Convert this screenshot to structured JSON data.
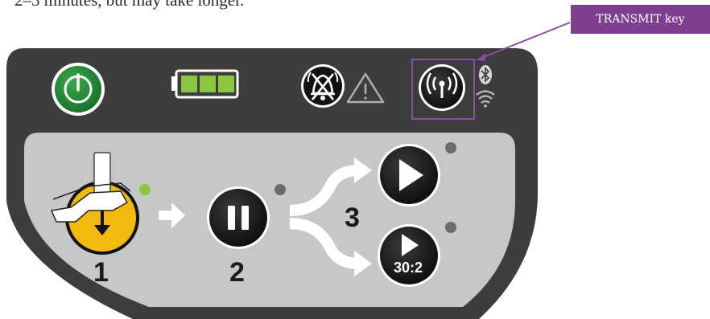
{
  "intro_text": "2–3 minutes, but may take longer.",
  "callout": {
    "label": "TRANSMIT key"
  },
  "status_bar": {
    "power_icon": "power-icon",
    "battery_icon": "battery-full-icon",
    "alarm_icon": "alarm-silenced-icon",
    "warning_icon": "warning-triangle-icon",
    "transmit_icon": "transmit-antenna-icon",
    "bluetooth_icon": "bluetooth-icon",
    "wifi_icon": "wifi-icon"
  },
  "steps": {
    "step1": "1",
    "step2": "2",
    "step3": "3",
    "ratio_label": "30:2"
  },
  "colors": {
    "panel": "#3c3d3f",
    "inner_panel": "#c6c7c9",
    "power_green": "#1e8b2e",
    "battery_green": "#8cc63f",
    "indicator_green": "#8cc63f",
    "callout_purple": "#7d3f8e",
    "pads_yellow": "#f2b90f"
  }
}
